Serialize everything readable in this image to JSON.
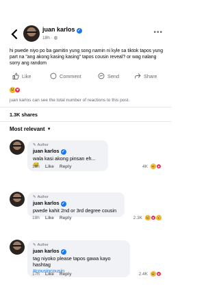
{
  "post": {
    "author": "juan karlos",
    "time": "18h",
    "privacy_icon": "globe-icon",
    "text": "hi pwede niyo po ba gamitin yung song namin ni kyle sa tiktok tapos yung part na \"ang akong kasing kasing\" tapos cousin reveal? or wag nalang sorry ang random",
    "actions": {
      "like": "Like",
      "comment": "Comment",
      "send": "Send",
      "share": "Share"
    },
    "reaction_note": "juan karlos can see the total number of reactions to this post.",
    "shares": "1.3K shares",
    "sort_label": "Most relevant"
  },
  "comments": [
    {
      "tag": "Author",
      "name": "juan karlos",
      "text": "wala kasi akong pinsan eh... 😅",
      "time": "18h",
      "like": "Like",
      "reply": "Reply",
      "count": "4K"
    },
    {
      "tag": "Author",
      "name": "juan karlos",
      "text": "pwede kahit 2nd or 3rd degree cousin",
      "time": "18h",
      "like": "Like",
      "reply": "Reply",
      "count": "2.3K"
    },
    {
      "tag": "Author",
      "name": "juan karlos",
      "text": "tag niyoko please tapos gawa kayo hashtag",
      "hashtag": "#cousincousin",
      "time": "17h",
      "like": "Like",
      "reply": "Reply",
      "count": "2.4K"
    }
  ],
  "colors": {
    "verified": "#1877f2",
    "meta": "#65676b",
    "bubble": "#f0f2f5",
    "heart": "#f02849",
    "haha": "#f7b125"
  }
}
